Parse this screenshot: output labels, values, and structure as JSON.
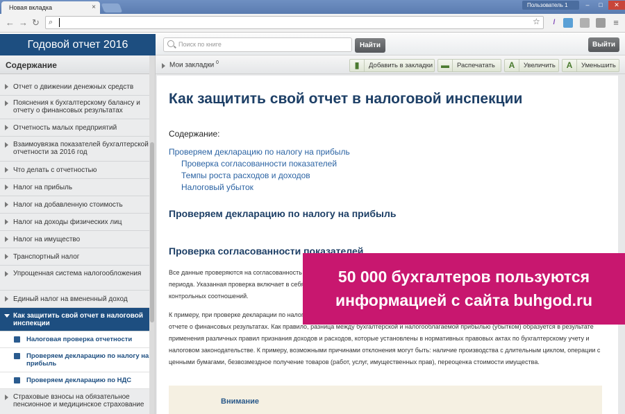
{
  "browser": {
    "tab_title": "Новая вкладка",
    "tab_close": "×",
    "user_label": "Пользователь 1",
    "url": ""
  },
  "app": {
    "title": "Годовой отчет 2016",
    "search_placeholder": "Поиск по книге",
    "search_button": "Найти",
    "logout_button": "Выйти"
  },
  "sidebar": {
    "header": "Содержание",
    "items": [
      {
        "label": "Отчет о движении денежных средств"
      },
      {
        "label": "Пояснения к бухгалтерскому балансу и отчету о финансовых результатах"
      },
      {
        "label": "Отчетность малых предприятий"
      },
      {
        "label": "Взаимоувязка показателей бухгалтерской отчетности за 2016 год"
      },
      {
        "label": "Что делать с отчетностью"
      },
      {
        "label": "Налог на прибыль"
      },
      {
        "label": "Налог на добавленную стоимость"
      },
      {
        "label": "Налог на доходы физических лиц"
      },
      {
        "label": "Налог на имущество"
      },
      {
        "label": "Транспортный налог"
      },
      {
        "label": "Упрощенная система налогообложения"
      },
      {
        "label": "Единый налог на вмененный доход"
      },
      {
        "label": "Как защитить свой отчет в налоговой инспекции"
      }
    ],
    "subitems": [
      {
        "label": "Налоговая проверка отчетности"
      },
      {
        "label": "Проверяем декларацию по налогу на прибыль"
      },
      {
        "label": "Проверяем декларацию по НДС"
      }
    ],
    "last_item": "Страховые взносы на обязательное пенсионное и медицинское страхование"
  },
  "toolbar": {
    "bookmarks_label": "Мои закладки",
    "bookmarks_count": "0",
    "add_bookmark": "Добавить в закладки",
    "print": "Распечатать",
    "zoom_in": "Увеличить",
    "zoom_out": "Уменьшить",
    "zoom_glyph": "A"
  },
  "article": {
    "title": "Как защитить свой отчет в налоговой инспекции",
    "toc_title": "Содержание:",
    "toc": [
      "Проверяем декларацию по налогу на прибыль",
      "Проверка согласованности показателей",
      "Темпы роста расходов и доходов",
      "Налоговый убыток"
    ],
    "section1": "Проверяем декларацию по налогу на прибыль",
    "section2": "Проверка согласованности показателей",
    "para1_l1": "Все данные проверяются на согласованность",
    "para1_l2": "периода. Указанная проверка включает в себя",
    "para1_l3": "контрольных соотношений.",
    "para2_l1": "К примеру, при проверке декларации по налогу",
    "para2_l2": "отчете о финансовых результатах. Как правило, разница между бухгалтерской и налогооблагаемой прибылью (убытком) образуется в результате",
    "para2_l3": "применения различных правил признания доходов и расходов, которые установлены в нормативных правовых актах по бухгалтерскому учету и",
    "para2_l4": "налоговом законодательстве. К примеру, возможными причинами отклонения могут быть: наличие производства с длительным циклом, операции с",
    "para2_l5": "ценными бумагами, безвозмездное получение товаров (работ, услуг, имущественных прав), переоценка стоимости имущества.",
    "attention_title": "Внимание"
  },
  "promo": {
    "line1": "50 000 бухгалтеров пользуются",
    "line2": "информацией с сайта buhgod.ru"
  },
  "colors": {
    "header_blue": "#1d4e80",
    "promo_magenta": "#c8176f",
    "link_blue": "#2b63a3"
  }
}
